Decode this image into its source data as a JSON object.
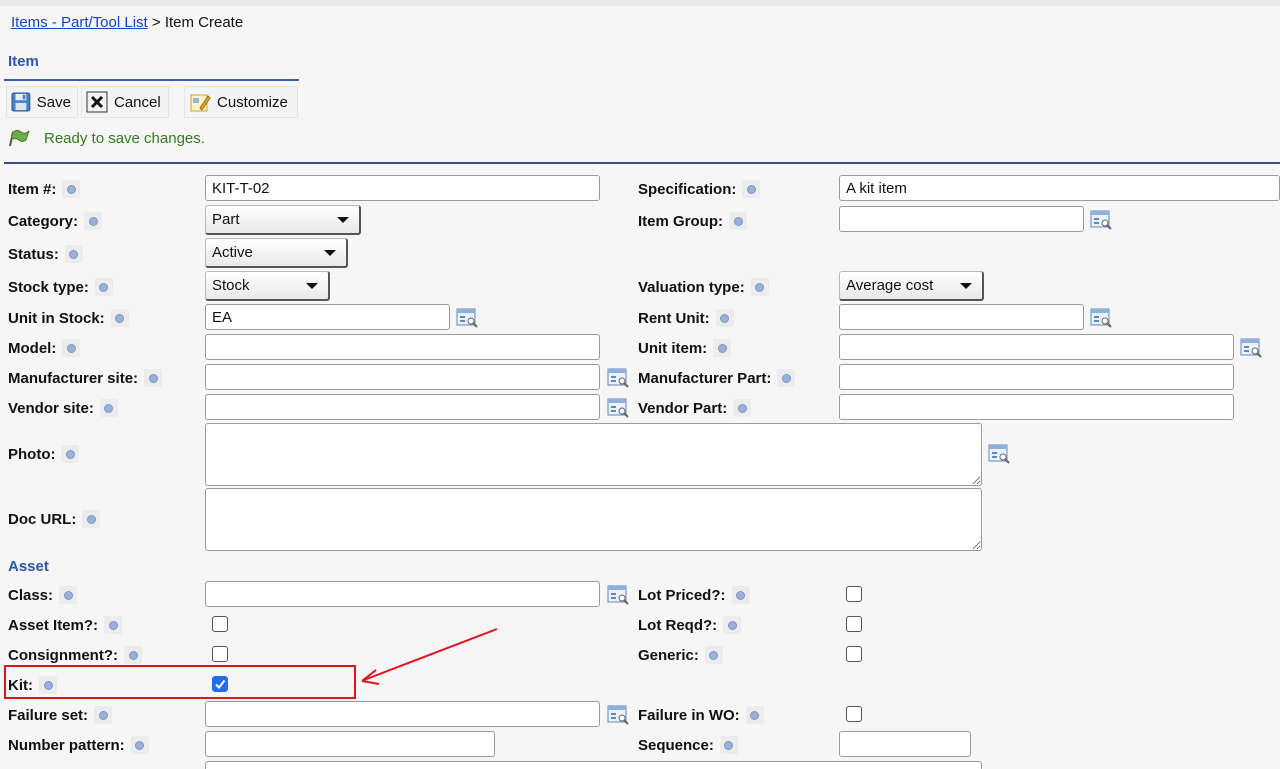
{
  "breadcrumb": {
    "link": "Items - Part/Tool List",
    "sep": ">",
    "current": "Item Create"
  },
  "section": {
    "title": "Item"
  },
  "toolbar": {
    "save": "Save",
    "cancel": "Cancel",
    "customize": "Customize"
  },
  "status": {
    "message": "Ready to save changes."
  },
  "fields": {
    "item_no": {
      "label": "Item #:",
      "value": "KIT-T-02"
    },
    "specification": {
      "label": "Specification:",
      "value": "A kit item"
    },
    "category": {
      "label": "Category:",
      "value": "Part"
    },
    "item_group": {
      "label": "Item Group:",
      "value": ""
    },
    "status": {
      "label": "Status:",
      "value": "Active"
    },
    "stock_type": {
      "label": "Stock type:",
      "value": "Stock"
    },
    "valuation_type": {
      "label": "Valuation type:",
      "value": "Average cost"
    },
    "unit_in_stock": {
      "label": "Unit in Stock:",
      "value": "EA"
    },
    "rent_unit": {
      "label": "Rent Unit:",
      "value": ""
    },
    "model": {
      "label": "Model:",
      "value": ""
    },
    "unit_item": {
      "label": "Unit item:",
      "value": ""
    },
    "manufacturer_site": {
      "label": "Manufacturer site:",
      "value": ""
    },
    "manufacturer_part": {
      "label": "Manufacturer Part:",
      "value": ""
    },
    "vendor_site": {
      "label": "Vendor site:",
      "value": ""
    },
    "vendor_part": {
      "label": "Vendor Part:",
      "value": ""
    },
    "photo": {
      "label": "Photo:",
      "value": ""
    },
    "doc_url": {
      "label": "Doc URL:",
      "value": ""
    }
  },
  "asset": {
    "title": "Asset",
    "class": {
      "label": "Class:",
      "value": ""
    },
    "lot_priced": {
      "label": "Lot Priced?:",
      "checked": false
    },
    "asset_item": {
      "label": "Asset Item?:",
      "checked": false
    },
    "lot_reqd": {
      "label": "Lot Reqd?:",
      "checked": false
    },
    "consignment": {
      "label": "Consignment?:",
      "checked": false
    },
    "generic": {
      "label": "Generic:",
      "checked": false
    },
    "kit": {
      "label": "Kit:",
      "checked": true
    },
    "failure_set": {
      "label": "Failure set:",
      "value": ""
    },
    "failure_in_wo": {
      "label": "Failure in WO:",
      "checked": false
    },
    "number_pattern": {
      "label": "Number pattern:",
      "value": ""
    },
    "sequence": {
      "label": "Sequence:",
      "value": ""
    }
  },
  "colors": {
    "link": "#1a3fcf",
    "section": "#2a56b0",
    "status": "#2f7d1b",
    "highlight": "#e0141d",
    "checkbox": "#1f6ff0"
  },
  "icons": [
    "save-icon",
    "cancel-icon",
    "customize-icon",
    "flag-icon",
    "help-icon",
    "lookup-icon",
    "check-icon",
    "arrow-annotation"
  ]
}
